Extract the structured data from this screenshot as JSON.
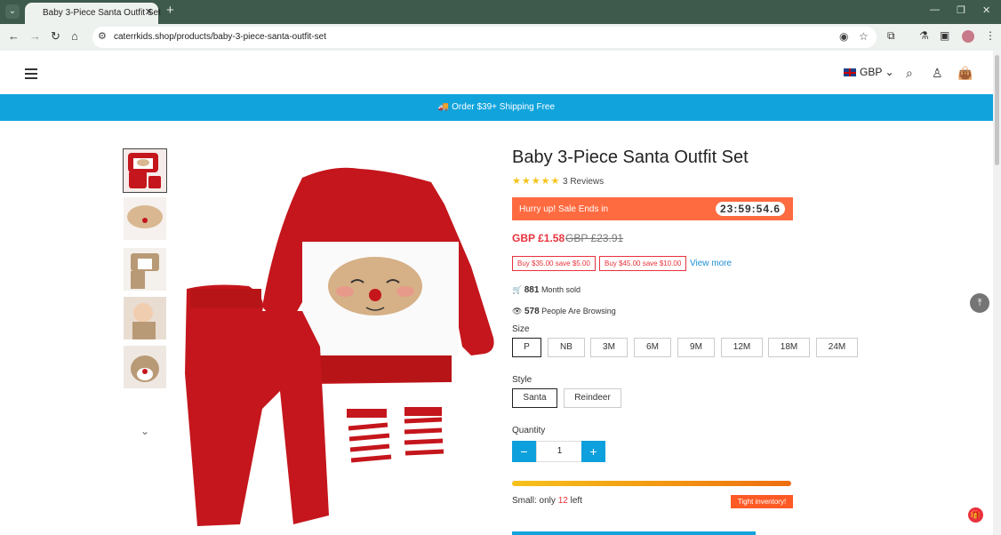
{
  "browser": {
    "tab_title": "Baby 3-Piece Santa Outfit Set",
    "url": "caterrkids.shop/products/baby-3-piece-santa-outfit-set"
  },
  "header": {
    "currency": "GBP"
  },
  "promo": {
    "text": "🚚 Order $39+ Shipping Free"
  },
  "product": {
    "title": "Baby 3-Piece Santa Outfit Set",
    "stars": "★★★★★",
    "reviews": "3 Reviews",
    "sale_text": "Hurry up! Sale Ends in",
    "timer": "23:59:54.6",
    "price": "GBP £1.58",
    "old_price": "GBP £23.91",
    "coupons": [
      "Buy $35.00 save $5.00",
      "Buy $45.00 save $10.00"
    ],
    "view_more": "View more",
    "sold_count": "881",
    "sold_label": "Month sold",
    "browsing_count": "578",
    "browsing_label": "People Are Browsing",
    "size_label": "Size",
    "sizes": [
      "P",
      "NB",
      "3M",
      "6M",
      "9M",
      "12M",
      "18M",
      "24M"
    ],
    "selected_size": "P",
    "style_label": "Style",
    "styles": [
      "Santa",
      "Reindeer"
    ],
    "selected_style": "Santa",
    "quantity_label": "Quantity",
    "quantity": "1",
    "stock_prefix": "Small: only",
    "stock_count": "12",
    "stock_suffix": "left",
    "tight_label": "Tight inventory!"
  }
}
